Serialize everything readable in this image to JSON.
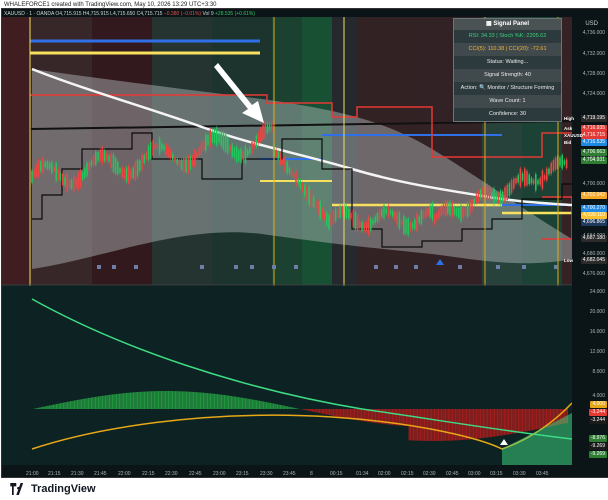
{
  "header": {
    "caption": "WHALEFORCE1 created with TradingView.com, May 10, 2026 13:29 UTC+3:30"
  },
  "symbol_bar": {
    "symbol": "XAUUSD · 1 · OANDA",
    "ohlc": "O4,715.915  H4,715.915  L4,715.650  C4,715.715",
    "change": "−0.380 (−0.01%)",
    "volume": "Vol 9",
    "extra": "+28.535 (+0.61%)"
  },
  "signal_panel": {
    "title": "Signal Panel",
    "rsi": "RSI: 34.33 | Stoch %K: 2205.62",
    "cci": "CCI(5): 110.38 | CCI(20): -72.61",
    "status": "Status: Waiting...",
    "strength": "Signal Strength: 40",
    "action": "Action: 🔍 Monitor / Structure Forming",
    "wave": "Wave Count: 1",
    "confidence": "Confidence: 30"
  },
  "currency": "USD",
  "price_axis": [
    "4,736.000",
    "4,732.000",
    "4,728.000",
    "4,724.000",
    "4,712.000",
    "4,708.000",
    "4,700.000",
    "4,692.000",
    "4,684.000",
    "4,680.000",
    "4,676.000"
  ],
  "price_tags": [
    {
      "value": "4,719.195",
      "color": "#2b2b2b",
      "label": "High"
    },
    {
      "value": "4,716.935",
      "color": "#e53935",
      "label": "Ask"
    },
    {
      "value": "4,716.715",
      "color": "#e53935",
      "label": "XAUUSD"
    },
    {
      "value": "4,716.535",
      "color": "#1e88e5",
      "label": "Bid"
    },
    {
      "value": "4,706.663",
      "color": "#2e7d32",
      "label": ""
    },
    {
      "value": "4,704.931",
      "color": "#2e7d32",
      "label": ""
    },
    {
      "value": "4,702.042",
      "color": "#f9a825",
      "label": ""
    },
    {
      "value": "4,700.270",
      "color": "#1e88e5",
      "label": ""
    },
    {
      "value": "4,699.110",
      "color": "#fbc02d",
      "label": ""
    },
    {
      "value": "4,696.865",
      "color": "#1e3a5f",
      "label": ""
    },
    {
      "value": "4,687.180",
      "color": "#2b2b2b",
      "label": ""
    },
    {
      "value": "4,682.045",
      "color": "#2b2b2b",
      "label": "Low"
    }
  ],
  "osc_axis": [
    "24.000",
    "20.000",
    "16.000",
    "12.000",
    "8.000",
    "4.000"
  ],
  "osc_tags": [
    {
      "value": "4.000",
      "color": "#e6a817"
    },
    {
      "value": "-3.244",
      "color": "#e53935"
    },
    {
      "value": "-3.244",
      "color": "#1b1b1b"
    },
    {
      "value": "-8.976",
      "color": "#2e7d32"
    },
    {
      "value": "-9.269",
      "color": "#1b1b1b"
    },
    {
      "value": "-9.269",
      "color": "#2e7d32"
    }
  ],
  "time_axis": [
    "21:00",
    "21:15",
    "21:30",
    "21:45",
    "22:00",
    "22:15",
    "22:30",
    "22:45",
    "23:00",
    "23:15",
    "23:30",
    "23:45",
    "8",
    "00:15",
    "01:34",
    "02:00",
    "02:15",
    "02:30",
    "02:45",
    "03:00",
    "03:15",
    "03:30",
    "03:45"
  ],
  "footer": {
    "brand": "TradingView"
  },
  "colors": {
    "background": "#0b1416",
    "up": "#22c55e",
    "down": "#ef4444",
    "accent_yellow": "#ffeb3b",
    "accent_blue": "#2962ff"
  }
}
